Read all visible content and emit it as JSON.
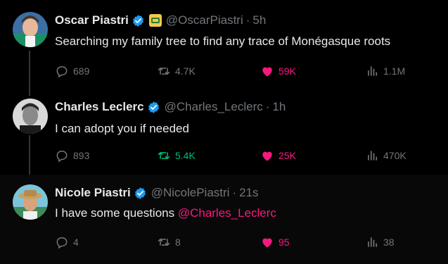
{
  "tweets": [
    {
      "name": "Oscar Piastri",
      "handle": "@OscarPiastri",
      "time": "5h",
      "text": "Searching my family tree to find any trace of Monégasque roots",
      "mention": "",
      "replies": "689",
      "retweets": "4.7K",
      "likes": "59K",
      "views": "1.1M",
      "liked": true,
      "retweeted": false,
      "affiliate_badge": true
    },
    {
      "name": "Charles Leclerc",
      "handle": "@Charles_Leclerc",
      "time": "1h",
      "text": "I can adopt you if needed",
      "mention": "",
      "replies": "893",
      "retweets": "5.4K",
      "likes": "25K",
      "views": "470K",
      "liked": true,
      "retweeted": true,
      "affiliate_badge": false
    },
    {
      "name": "Nicole Piastri",
      "handle": "@NicolePiastri",
      "time": "21s",
      "text": "I have some questions ",
      "mention": "@Charles_Leclerc",
      "replies": "4",
      "retweets": "8",
      "likes": "95",
      "views": "38",
      "liked": true,
      "retweeted": false,
      "affiliate_badge": false
    }
  ],
  "colors": {
    "background": "#000000",
    "text": "#e7e9ea",
    "muted": "#71767b",
    "like": "#f91880",
    "retweet": "#00ba7c",
    "verified": "#1d9bf0",
    "thread_line": "#333639"
  },
  "icons": [
    "verified-badge-icon",
    "affiliate-badge-icon",
    "reply-icon",
    "retweet-icon",
    "like-icon",
    "views-icon"
  ]
}
